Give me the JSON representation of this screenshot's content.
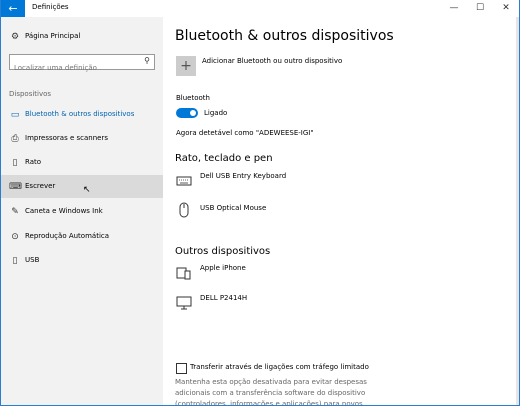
{
  "window": {
    "title": "Definições",
    "back_icon": "arrow-left-icon",
    "controls": [
      "minimize",
      "maximize",
      "close"
    ]
  },
  "sidebar": {
    "home_label": "Página Principal",
    "search_placeholder": "Localizar uma definição",
    "section_label": "Dispositivos",
    "items": [
      {
        "label": "Bluetooth & outros dispositivos",
        "icon": "bluetooth-devices-icon",
        "active": true
      },
      {
        "label": "Impressoras e scanners",
        "icon": "printer-icon"
      },
      {
        "label": "Rato",
        "icon": "mouse-icon"
      },
      {
        "label": "Escrever",
        "icon": "keyboard-icon",
        "hover": true
      },
      {
        "label": "Caneta e Windows Ink",
        "icon": "pen-icon"
      },
      {
        "label": "Reprodução Automática",
        "icon": "autoplay-icon"
      },
      {
        "label": "USB",
        "icon": "usb-icon"
      }
    ]
  },
  "main": {
    "title": "Bluetooth & outros dispositivos",
    "add_device_label": "Adicionar Bluetooth ou outro dispositivo",
    "bluetooth_label": "Bluetooth",
    "bluetooth_state": "Ligado",
    "discoverable_text": "Agora detetável como \"ADEWEESE-IGI\"",
    "section_input": "Rato, teclado e pen",
    "input_devices": [
      {
        "name": "Dell USB Entry Keyboard",
        "icon": "keyboard-icon"
      },
      {
        "name": "USB Optical Mouse",
        "icon": "mouse-icon"
      }
    ],
    "section_other": "Outros dispositivos",
    "other_devices": [
      {
        "name": "Apple iPhone",
        "icon": "phone-icon"
      },
      {
        "name": "DELL P2414H",
        "icon": "monitor-icon"
      }
    ],
    "metered_label": "Transferir através de ligações com tráfego limitado",
    "metered_description": "Mantenha esta opção desativada para evitar despesas adicionais com a transferência software do dispositivo (controladores, informações e aplicações) para novos dispositivos enquanto estiver"
  },
  "colors": {
    "accent": "#0078d7",
    "sidebar_bg": "#f2f2f2",
    "hover_bg": "#dadada"
  }
}
